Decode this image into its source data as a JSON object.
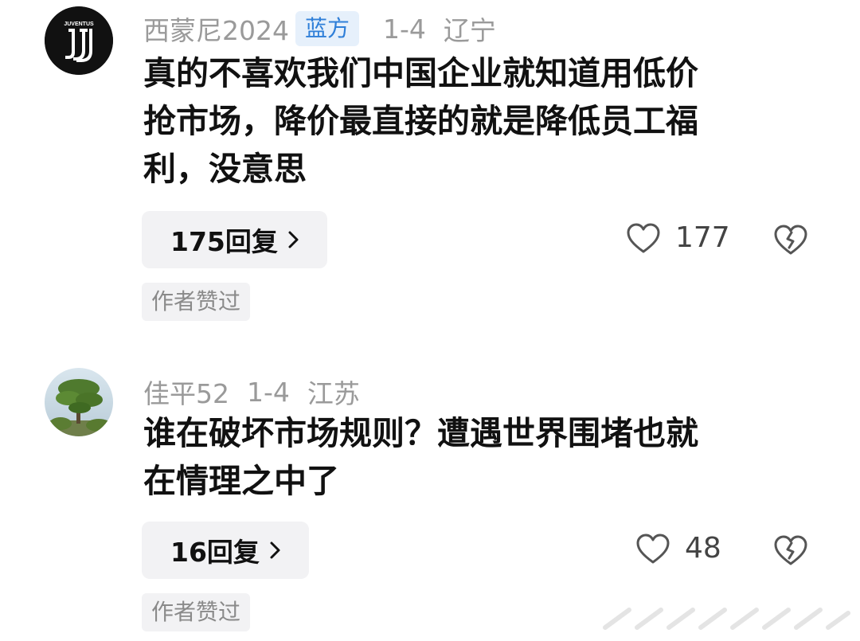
{
  "comments": [
    {
      "user": "西蒙尼2024",
      "badge": "蓝方",
      "date": "1-4",
      "location": "辽宁",
      "text_lines": [
        "真的不喜欢我们中国企业就知道用低价",
        "抢市场，降价最直接的就是降低员工福",
        "利，没意思"
      ],
      "reply_label": "175回复",
      "likes": "177",
      "author_liked": "作者赞过",
      "avatar_icon": "juventus-logo-icon"
    },
    {
      "user": "佳平52",
      "date": "1-4",
      "location": "江苏",
      "text_lines": [
        "谁在破坏市场规则？遭遇世界围堵也就",
        "在情理之中了"
      ],
      "reply_label": "16回复",
      "likes": "48",
      "author_liked": "作者赞过",
      "avatar_icon": "tree-photo-avatar"
    }
  ],
  "colors": {
    "meta_gray": "#9a9a9a",
    "badge_bg": "#e6f0fb",
    "badge_text": "#2f7fd8",
    "pill_bg": "#f2f2f4"
  }
}
